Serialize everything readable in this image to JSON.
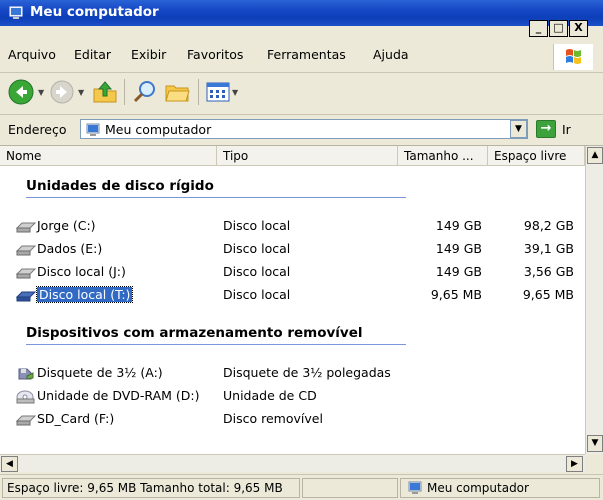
{
  "window": {
    "title": "Meu computador",
    "controls": {
      "minimize": "_",
      "maximize": "□",
      "close": "X"
    }
  },
  "menu": [
    "Arquivo",
    "Editar",
    "Exibir",
    "Favoritos",
    "Ferramentas",
    "Ajuda"
  ],
  "toolbar": {
    "buttons": [
      "back-icon",
      "forward-icon",
      "up-folder-icon",
      "search-icon",
      "folders-icon",
      "views-icon"
    ]
  },
  "address": {
    "label": "Endereço",
    "value": "Meu computador",
    "go_label": "Ir"
  },
  "columns": [
    "Nome",
    "Tipo",
    "Tamanho ...",
    "Espaço livre"
  ],
  "groups": [
    {
      "title": "Unidades de disco rígido",
      "items": [
        {
          "name": "Jorge (C:)",
          "type": "Disco local",
          "size": "149 GB",
          "free": "98,2 GB",
          "icon": "hard-drive-icon"
        },
        {
          "name": "Dados (E:)",
          "type": "Disco local",
          "size": "149 GB",
          "free": "39,1 GB",
          "icon": "hard-drive-icon"
        },
        {
          "name": "Disco local (J:)",
          "type": "Disco local",
          "size": "149 GB",
          "free": "3,56 GB",
          "icon": "hard-drive-icon"
        },
        {
          "name": "Disco local (T:)",
          "type": "Disco local",
          "size": "9,65 MB",
          "free": "9,65 MB",
          "icon": "hard-drive-icon",
          "selected": true
        }
      ]
    },
    {
      "title": "Dispositivos com armazenamento removível",
      "items": [
        {
          "name": "Disquete de 3½ (A:)",
          "type": "Disquete de 3½ polegadas",
          "size": "",
          "free": "",
          "icon": "floppy-icon"
        },
        {
          "name": "Unidade de DVD-RAM (D:)",
          "type": "Unidade de CD",
          "size": "",
          "free": "",
          "icon": "dvd-drive-icon"
        },
        {
          "name": "SD_Card (F:)",
          "type": "Disco removível",
          "size": "",
          "free": "",
          "icon": "removable-drive-icon"
        }
      ]
    }
  ],
  "status": {
    "left": "Espaço livre: 9,65 MB Tamanho total: 9,65 MB",
    "right": "Meu computador"
  },
  "colors": {
    "titlebar": "#0e3fb9",
    "selection": "#316ac5",
    "group_line": "#7a96df"
  }
}
